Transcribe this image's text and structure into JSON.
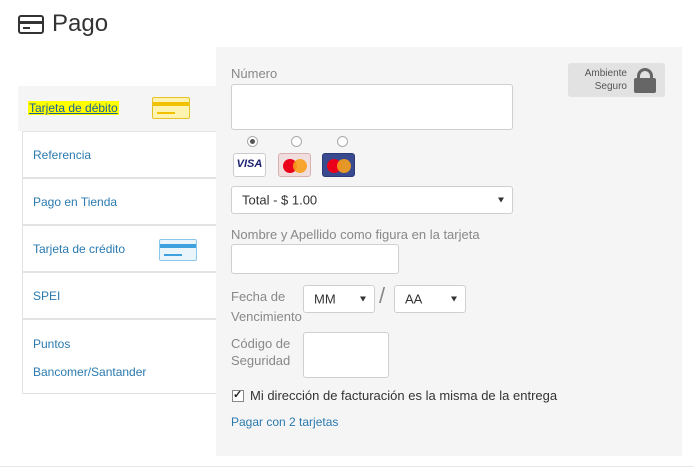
{
  "header": {
    "title": "Pago",
    "icon": "credit-card-icon"
  },
  "sidebar": {
    "items": [
      {
        "label": "Tarjeta de débito",
        "active": true,
        "icon": "debit-card-icon"
      },
      {
        "label": "Referencia"
      },
      {
        "label": "Pago en Tienda"
      },
      {
        "label": "Tarjeta de crédito",
        "icon": "credit-card-icon"
      },
      {
        "label": "SPEI"
      },
      {
        "label_line1": "Puntos",
        "label_line2": "Bancomer/Santander"
      }
    ]
  },
  "form": {
    "numero_label": "Número",
    "numero_value": "",
    "secure_line1": "Ambiente",
    "secure_line2": "Seguro",
    "card_brands": [
      "VISA",
      "MasterCard",
      "MasterCard"
    ],
    "selected_brand_index": 0,
    "total_select": "Total - $ 1.00",
    "name_label": "Nombre y Apellido como figura en la tarjeta",
    "name_value": "",
    "expiry_label_line1": "Fecha de",
    "expiry_label_line2": "Vencimiento",
    "month_select": "MM",
    "year_select": "AA",
    "slash": "/",
    "cvv_label_line1": "Código de",
    "cvv_label_line2": "Seguridad",
    "cvv_value": "",
    "billing_checkbox_label": "Mi dirección de facturación es la misma de la entrega",
    "billing_checked": true,
    "two_cards_link": "Pagar con 2 tarjetas"
  },
  "colors": {
    "accent_link": "#2a7ab0",
    "highlight": "#ffff00",
    "panel_bg": "#f5f5f5"
  }
}
